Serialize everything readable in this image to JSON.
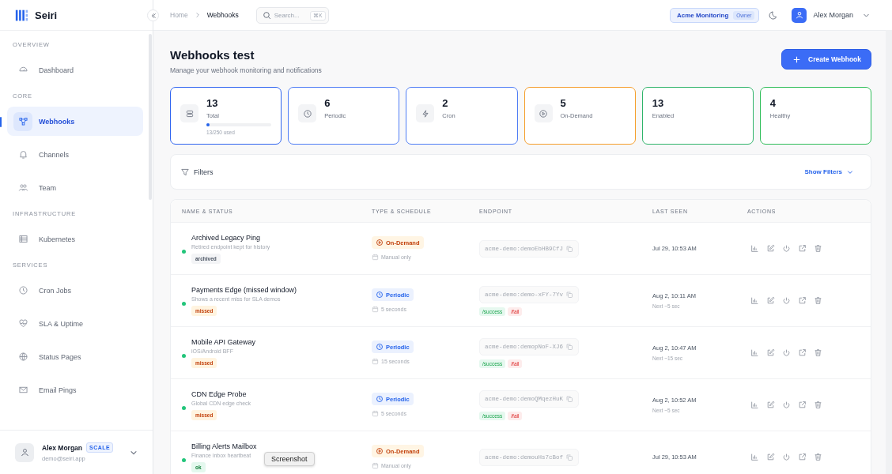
{
  "app": {
    "name": "Seiri"
  },
  "breadcrumb": [
    {
      "label": "Home",
      "selected": false
    },
    {
      "label": "Webhooks",
      "selected": true
    }
  ],
  "search": {
    "placeholder": "Search...",
    "shortcut": "⌘K"
  },
  "org": {
    "name": "Acme Monitoring",
    "role": "Owner"
  },
  "user_menu": {
    "name": "Alex Morgan"
  },
  "sidebar": {
    "sections": [
      {
        "title": "OVERVIEW",
        "items": [
          {
            "label": "Dashboard",
            "selected": false
          }
        ]
      },
      {
        "title": "CORE",
        "items": [
          {
            "label": "Webhooks",
            "selected": true
          },
          {
            "label": "Channels",
            "selected": false
          },
          {
            "label": "Team",
            "selected": false
          }
        ]
      },
      {
        "title": "INFRASTRUCTURE",
        "items": [
          {
            "label": "Kubernetes",
            "selected": false
          }
        ]
      },
      {
        "title": "SERVICES",
        "items": [
          {
            "label": "Cron Jobs",
            "selected": false
          },
          {
            "label": "SLA & Uptime",
            "selected": false
          },
          {
            "label": "Status Pages",
            "selected": false
          },
          {
            "label": "Email Pings",
            "selected": false
          }
        ]
      }
    ]
  },
  "account": {
    "name": "Alex Morgan",
    "plan": "SCALE",
    "email": "demo@seiri.app"
  },
  "page": {
    "title": "Webhooks test",
    "subtitle": "Manage your webhook monitoring and notifications",
    "create_button": "Create Webhook"
  },
  "stats": [
    {
      "kind": "total",
      "value": "13",
      "label": "Total",
      "color": "#2f64f0",
      "level": 0.052,
      "usage": "13/250 used"
    },
    {
      "kind": "periodic",
      "value": "6",
      "label": "Periodic",
      "color": "#4f7df5"
    },
    {
      "kind": "cron",
      "value": "2",
      "label": "Cron",
      "color": "#4f7df5"
    },
    {
      "kind": "on-demand",
      "value": "5",
      "label": "On-Demand",
      "color": "#f59e2b"
    },
    {
      "kind": "plain",
      "value": "13",
      "label": "Enabled",
      "color": "#2fb46a"
    },
    {
      "kind": "plain",
      "value": "4",
      "label": "Healthy",
      "color": "#2ebd58"
    }
  ],
  "filters": {
    "label": "Filters",
    "toggle": "Show Filters"
  },
  "table": {
    "columns": [
      "NAME & STATUS",
      "TYPE & SCHEDULE",
      "ENDPOINT",
      "LAST SEEN",
      "ACTIONS"
    ],
    "rows": [
      {
        "name": "Archived Legacy Ping",
        "description": "Retired endpoint kept for history",
        "color": "#22c57a",
        "tag": {
          "label": "archived",
          "kind": "archived"
        },
        "type": {
          "label": "On-Demand",
          "kind": "on-demand"
        },
        "schedule": "Manual only",
        "endpoint": "acme-demo:demoEbHB9CfJ",
        "last_seen": "Jul 29, 10:53 AM"
      },
      {
        "name": "Payments Edge (missed window)",
        "description": "Shows a recent miss for SLA demos",
        "color": "#22c57a",
        "tag": {
          "label": "missed",
          "kind": "missed"
        },
        "type": {
          "label": "Periodic",
          "kind": "periodic"
        },
        "schedule": "5 seconds",
        "endpoint": "acme-demo:demo-xFY-7Yv",
        "links": [
          {
            "label": "/success",
            "kind": "success"
          },
          {
            "label": "/fail",
            "kind": "fail"
          }
        ],
        "last_seen": "Aug 2, 10:11 AM",
        "next": "Next ~5 sec"
      },
      {
        "name": "Mobile API Gateway",
        "description": "iOS/Android BFF",
        "color": "#22c57a",
        "tag": {
          "label": "missed",
          "kind": "missed"
        },
        "type": {
          "label": "Periodic",
          "kind": "periodic"
        },
        "schedule": "15 seconds",
        "endpoint": "acme-demo:demopNoF-XJ6",
        "links": [
          {
            "label": "/success",
            "kind": "success"
          },
          {
            "label": "/fail",
            "kind": "fail"
          }
        ],
        "last_seen": "Aug 2, 10:47 AM",
        "next": "Next ~15 sec"
      },
      {
        "name": "CDN Edge Probe",
        "description": "Global CDN edge check",
        "color": "#22c57a",
        "tag": {
          "label": "missed",
          "kind": "missed"
        },
        "type": {
          "label": "Periodic",
          "kind": "periodic"
        },
        "schedule": "5 seconds",
        "endpoint": "acme-demo:demoQMqezHuK",
        "links": [
          {
            "label": "/success",
            "kind": "success"
          },
          {
            "label": "/fail",
            "kind": "fail"
          }
        ],
        "last_seen": "Aug 2, 10:52 AM",
        "next": "Next ~5 sec"
      },
      {
        "name": "Billing Alerts Mailbox",
        "description": "Finance inbox heartbeat",
        "color": "#22c57a",
        "tag": {
          "label": "ok",
          "kind": "ok"
        },
        "type": {
          "label": "On-Demand",
          "kind": "on-demand"
        },
        "schedule": "Manual only",
        "endpoint": "acme-demo:demouHs7cBof",
        "last_seen": "Jul 29, 10:53 AM"
      }
    ]
  },
  "tooltip": "Screenshot"
}
